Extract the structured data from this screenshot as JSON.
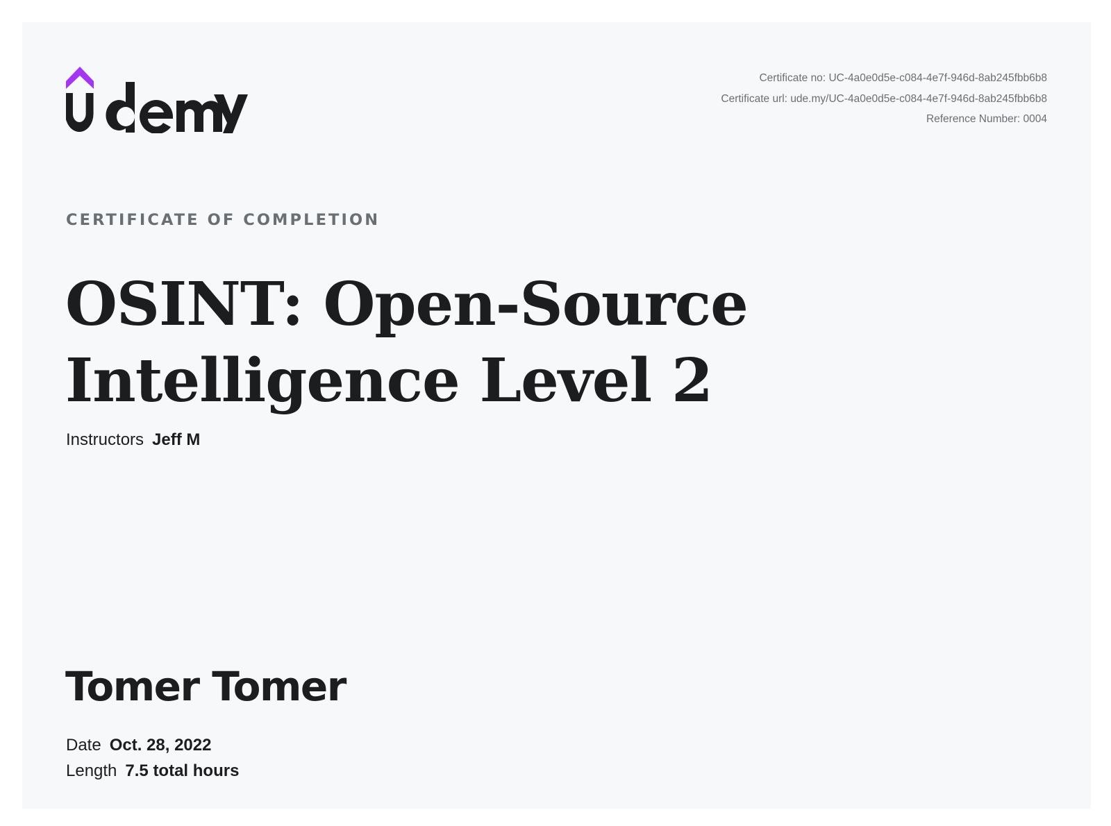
{
  "brand": {
    "logo_text": "udemy",
    "accent_color": "#a435f0"
  },
  "meta": {
    "certificate_no_label": "Certificate no:",
    "certificate_no": "UC-4a0e0d5e-c084-4e7f-946d-8ab245fbb6b8",
    "certificate_url_label": "Certificate url:",
    "certificate_url": "ude.my/UC-4a0e0d5e-c084-4e7f-946d-8ab245fbb6b8",
    "reference_label": "Reference Number:",
    "reference_number": "0004"
  },
  "certificate": {
    "eyebrow": "CERTIFICATE OF COMPLETION",
    "course_title": "OSINT: Open-Source Intelligence Level 2",
    "instructors_label": "Instructors",
    "instructors": "Jeff M",
    "recipient_name": "Tomer Tomer",
    "date_label": "Date",
    "date": "Oct. 28, 2022",
    "length_label": "Length",
    "length": "7.5 total hours"
  },
  "colors": {
    "text_primary": "#1c1d1f",
    "text_muted": "#6a6f73",
    "sheet_background": "#f7f8fa"
  }
}
